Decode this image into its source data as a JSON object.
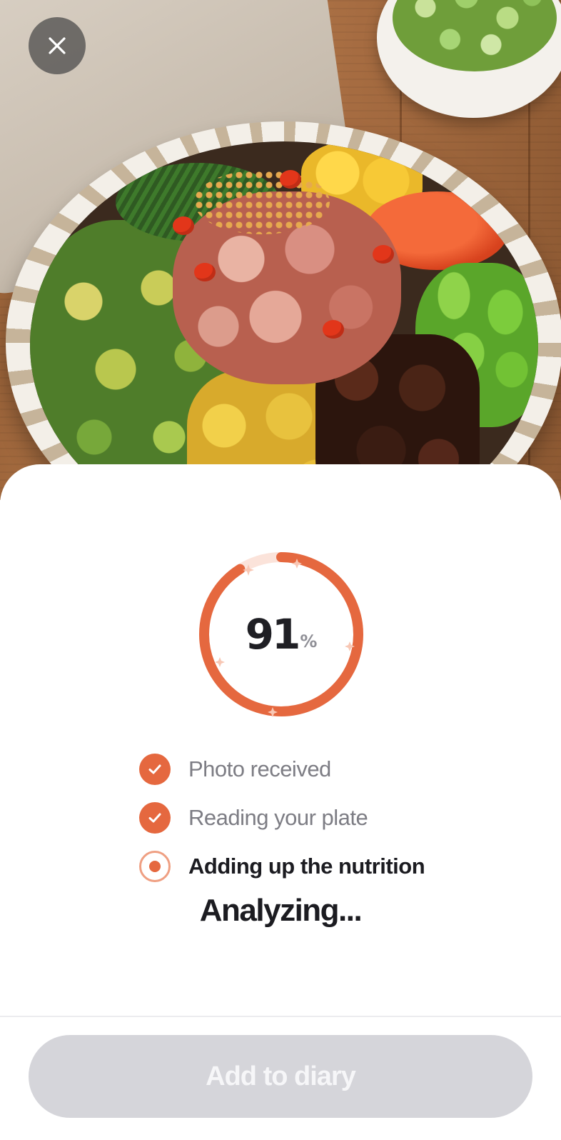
{
  "photo": {
    "subject": "poke-bowl-photo"
  },
  "close_button": {
    "icon": "close-icon"
  },
  "progress": {
    "value": 91,
    "value_label": "91",
    "unit_label": "%",
    "ring_color": "#e5683f",
    "track_color": "#fbe3da"
  },
  "steps": [
    {
      "label": "Photo received",
      "state": "done"
    },
    {
      "label": "Reading your plate",
      "state": "done"
    },
    {
      "label": "Adding up the nutrition",
      "state": "active"
    }
  ],
  "status_text": "Analyzing...",
  "footer": {
    "add_button_label": "Add to diary",
    "disabled": true
  }
}
